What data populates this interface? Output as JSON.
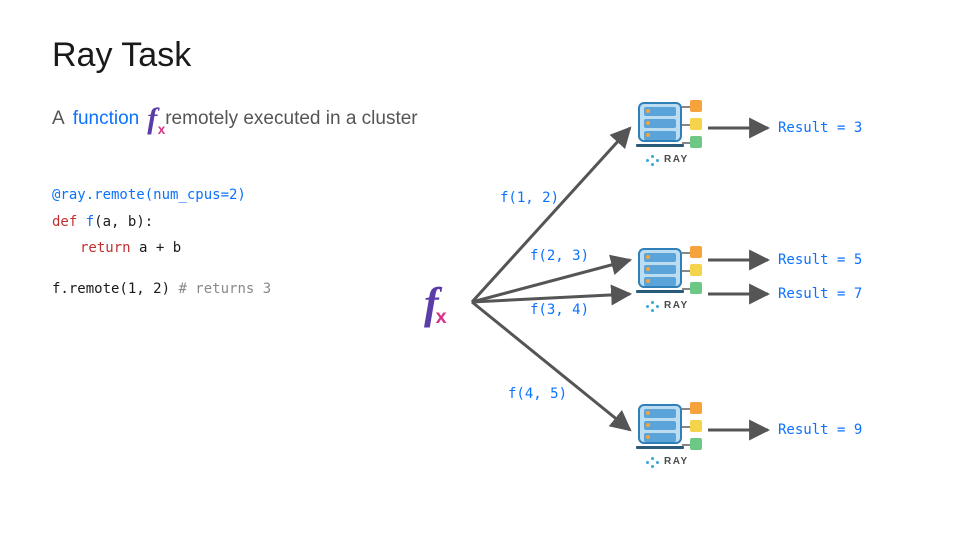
{
  "title": "Ray Task",
  "subtitle": {
    "a": "A",
    "function": "function",
    "rest": "remotely executed in a cluster"
  },
  "code": {
    "decorator": "@ray.remote(num_cpus=2)",
    "def_kw": "def",
    "fn_name": "f",
    "params": "(a, b):",
    "return_kw": "return",
    "return_expr": "a + b",
    "call": "f.remote(1, 2)",
    "comment": "# returns 3"
  },
  "calls": [
    {
      "label": "f(1, 2)",
      "result": "Result = 3"
    },
    {
      "label": "f(2, 3)",
      "result": "Result = 5"
    },
    {
      "label": "f(3, 4)",
      "result": "Result = 7"
    },
    {
      "label": "f(4, 5)",
      "result": "Result = 9"
    }
  ],
  "ray_label": "RAY",
  "fx_glyph": "f",
  "fx_x": "x"
}
